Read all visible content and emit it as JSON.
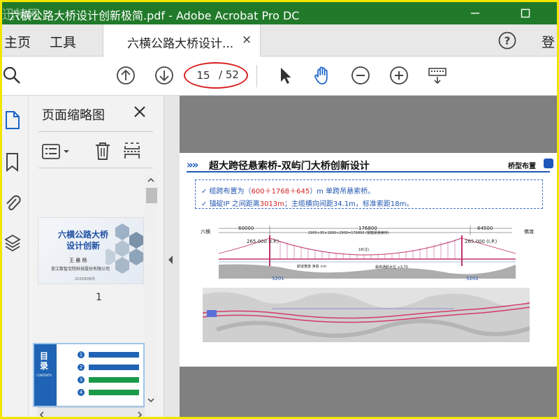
{
  "window": {
    "title": "六横公路大桥设计创新极简.pdf - Adobe Acrobat Pro DC",
    "watermark": "迅特网"
  },
  "menu": {
    "home": "主页",
    "tools": "工具",
    "doc_tab": "六横公路大桥设计...",
    "close_tab": "×",
    "sign_in": "登"
  },
  "toolbar": {
    "current_page": "15",
    "total_pages": "/ 52"
  },
  "thumbnails": {
    "title": "页面缩略图",
    "page1": {
      "title_line1": "六横公路大桥",
      "title_line2": "设计创新",
      "author": "王 晨 杨",
      "org": "浙江数智交院科技股份有限公司",
      "date": "2020年08月",
      "number": "1"
    },
    "page2": {
      "heading_line1": "目",
      "heading_line2": "录",
      "heading_en": "CONTENTS",
      "items": [
        "1",
        "2",
        "3",
        "4"
      ]
    }
  },
  "document": {
    "page_title": "超大跨径悬索桥-双屿门大桥创新设计",
    "chevrons": "»»",
    "badge": "桥型布置",
    "note1_prefix": "✓ 缆跨布置为（",
    "note1_span": "600＋1768＋645",
    "note1_suffix": "）m 单跨吊悬索桥。",
    "note2_prefix": "✓ 锚碇IP 之间距离",
    "note2_value": "3013m",
    "note2_suffix": "；主缆横向间距34.1m，标准索距18m。",
    "elevation_labels": {
      "left": "六横",
      "right": "佛渡",
      "dim_left": "60000",
      "dim_mid": "176800",
      "dim_right": "64500",
      "span_detail": "2900+95×1800+2900=176800 (钢箱梁悬索桥)",
      "ip_left": "265.000 (I.P.)",
      "ip_right": "265.000 (I.P.)",
      "tower_height": "18(注)",
      "water": "最高通航水位 +3.70",
      "pier_left": "S201",
      "pier_right": "S202",
      "nav": "航道宽度 净高 ×m"
    }
  },
  "colors": {
    "titlebar": "#217a2a",
    "accent_blue": "#1d58b8",
    "highlight_red": "#d61f1f"
  }
}
